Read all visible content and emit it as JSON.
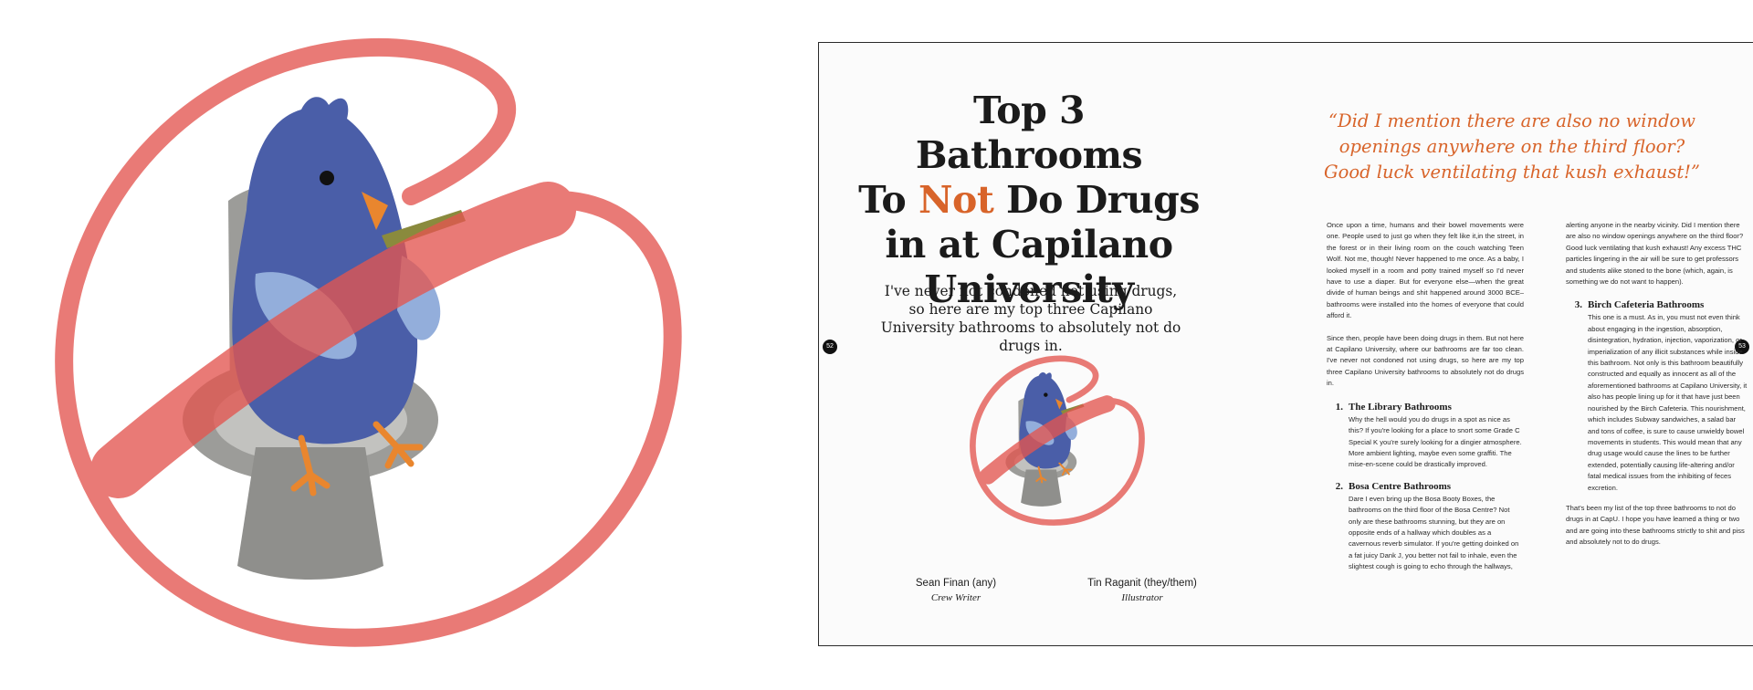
{
  "spread": {
    "title": {
      "line1": "Top 3 Bathrooms",
      "line2_pre": "To ",
      "line2_em": "Not",
      "line2_post": " Do Drugs",
      "line3": "in at Capilano",
      "line4": "University"
    },
    "subtitle": "I've never not condoned not using drugs, so here are my top three Capilano University bathrooms to absolutely not do drugs in.",
    "credits": [
      {
        "name": "Sean Finan (any)",
        "role": "Crew Writer"
      },
      {
        "name": "Tin Raganit (they/them)",
        "role": "Illustrator"
      }
    ],
    "page_numbers": {
      "left": "52",
      "right": "53"
    },
    "pull_quote": "“Did I mention there are also no window openings anywhere on the third floor? Good luck ventilating that kush exhaust!”",
    "intro": [
      "Once upon a time, humans and their bowel movements were one. People used to just go when they felt like it,in the street, in the forest or in their living room on the couch watching Teen Wolf. Not me, though! Never happened to me once. As a baby, I looked myself in a room and potty trained myself so I'd never have to use a diaper. But for everyone else—when the great divide of human beings and shit happened around 3000 BCE– bathrooms were installed into the homes of everyone that could afford it.",
      "Since then, people have been doing drugs in them. But not here at Capilano University, where our bathrooms are far too clean. I've never not condoned not using drugs, so here are my top three Capilano University bathrooms to absolutely not do drugs in."
    ],
    "items": [
      {
        "number": "1.",
        "heading": "The Library Bathrooms",
        "body": "Why the hell would you do drugs in a spot as nice as this? If you're looking for a place to snort some Grade C Special K you're surely looking for a dingier atmosphere. More ambient lighting, maybe even some graffiti. The mise-en-scene could be drastically improved."
      },
      {
        "number": "2.",
        "heading": "Bosa Centre Bathrooms",
        "body": "Dare I even bring up the Bosa Booty Boxes, the bathrooms on the third floor of the Bosa Centre? Not only are these bathrooms stunning, but they are on opposite ends of a hallway which doubles as a cavernous reverb simulator. If you're getting doinked on a fat juicy Dank J, you better not fail to inhale, even the slightest cough is going to echo through the hallways,"
      }
    ],
    "col2_continuation": "alerting anyone in the nearby vicinity. Did I mention there are also no window openings anywhere on the third floor? Good luck ventilating that kush exhaust! Any excess THC particles lingering in the air will be sure to get professors and students alike stoned to the bone (which, again, is something we do not want to happen).",
    "item3": {
      "number": "3.",
      "heading": "Birch Cafeteria Bathrooms",
      "body": "This one is a must. As in, you must not even think about engaging in the ingestion, absorption, disintegration, hydration, injection, vaporization, or imperialization of any illicit substances while inside this bathroom. Not only is this bathroom beautifully constructed and equally as innocent as all of the aforementioned bathrooms at Capilano University, it also has people lining up for it that have just been nourished by the Birch Cafeteria. This nourishment, which includes Subway sandwiches, a salad bar and tons of coffee, is sure to cause unwieldy bowel movements in students. This would mean that any drug usage would cause the lines to be further extended, potentially causing life-altering and/or fatal medical issues from the inhibiting of feces excretion."
    },
    "closing": "That's been my list of the top three bathrooms to not do drugs in at CapU. I hope you have learned a thing or two and are going into these bathrooms strictly to shit and piss and absolutely not to do drugs."
  }
}
